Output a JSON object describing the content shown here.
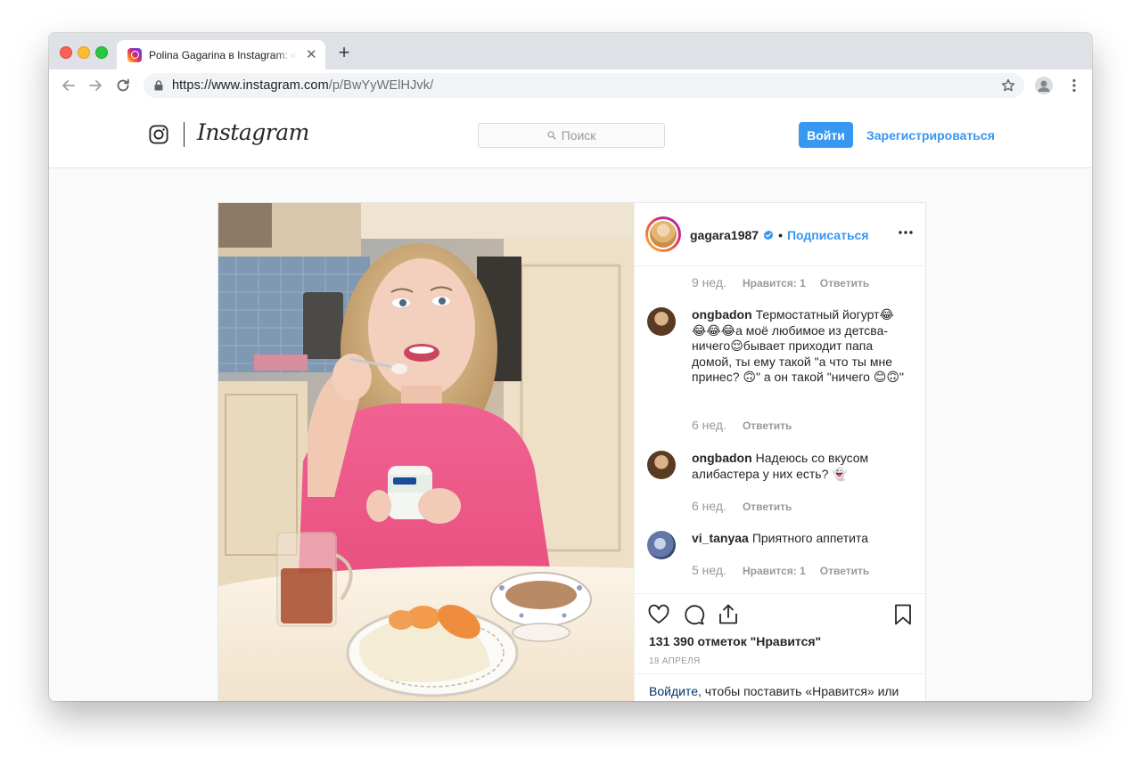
{
  "browser": {
    "tab_title": "Polina Gagarina в Instagram: «",
    "url_main": "https://www.instagram.com",
    "url_path": "/p/BwYyWElHJvk/",
    "colors": {
      "tab_strip": "#dee1e6",
      "omnibox": "#f1f3f4"
    }
  },
  "header": {
    "wordmark": "Instagram",
    "search_placeholder": "Поиск",
    "login_button": "Войти",
    "register_link": "Зарегистрироваться",
    "accent_color": "#3897f0"
  },
  "post": {
    "username": "gagara1987",
    "follow": "Подписаться",
    "separator": "•",
    "comments": [
      {
        "user": "",
        "text": "",
        "age": "9 нед.",
        "likes": "Нравится: 1",
        "reply": "Ответить"
      },
      {
        "user": "ongbadon",
        "text": "Термостатный йогурт😂😂😂😂а моё любимое из детсва- ничего😌бывает приходит папа домой, ты ему такой \"а что ты мне принес? 🙃\" а он такой \"ничего 😊🙃\"",
        "age": "6 нед.",
        "likes": "",
        "reply": "Ответить"
      },
      {
        "user": "ongbadon",
        "text": "Надеюсь со вкусом алибастера у них есть? 👻",
        "age": "6 нед.",
        "likes": "",
        "reply": "Ответить"
      },
      {
        "user": "vi_tanyaa",
        "text": "Приятного аппетита",
        "age": "5 нед.",
        "likes": "Нравится: 1",
        "reply": "Ответить"
      }
    ],
    "likes_count": "131 390 отметок \"Нравится\"",
    "date": "18 АПРЕЛЯ",
    "login_prompt_link": "Войдите",
    "login_prompt_rest": ", чтобы поставить «Нравится» или"
  },
  "icons": [
    "instagram-glyph-icon",
    "search-icon",
    "verified-badge-icon",
    "more-options-icon",
    "heart-icon",
    "comment-icon",
    "share-icon",
    "bookmark-icon",
    "lock-icon",
    "star-icon",
    "back-arrow-icon",
    "forward-arrow-icon",
    "reload-icon",
    "close-tab-icon",
    "new-tab-icon",
    "profile-icon",
    "menu-icon"
  ]
}
